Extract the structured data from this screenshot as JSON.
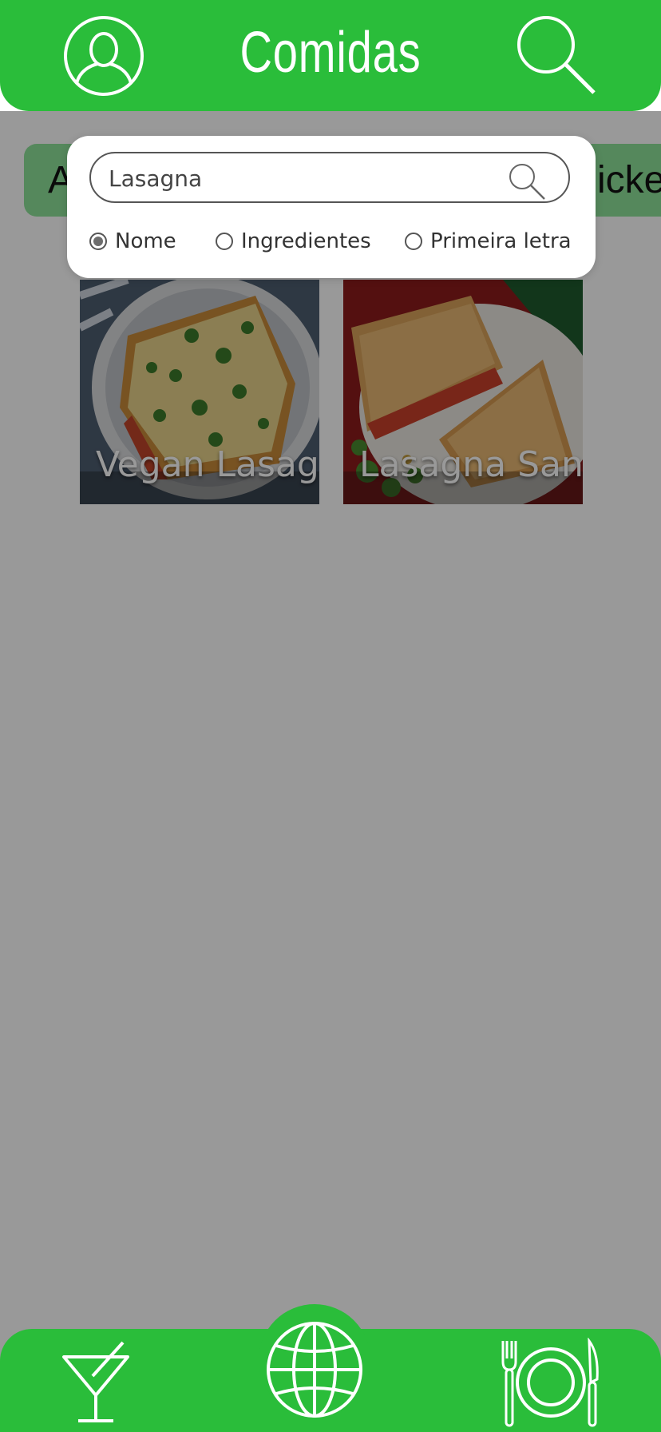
{
  "header": {
    "title": "Comidas"
  },
  "categories": {
    "left_label": "A",
    "right_label": "icke"
  },
  "search": {
    "value": "Lasagna",
    "options": [
      {
        "label": "Nome",
        "checked": true
      },
      {
        "label": "Ingredientes",
        "checked": false
      },
      {
        "label": "Primeira letra",
        "checked": false
      }
    ]
  },
  "results": [
    {
      "title": "Vegan Lasag"
    },
    {
      "title": "Lasagna Sanc"
    }
  ],
  "colors": {
    "brand_green": "#2abd3a",
    "category_green": "#8ee39a"
  },
  "nav": {
    "icons": [
      "cocktail-icon",
      "globe-icon",
      "utensils-icon"
    ]
  }
}
